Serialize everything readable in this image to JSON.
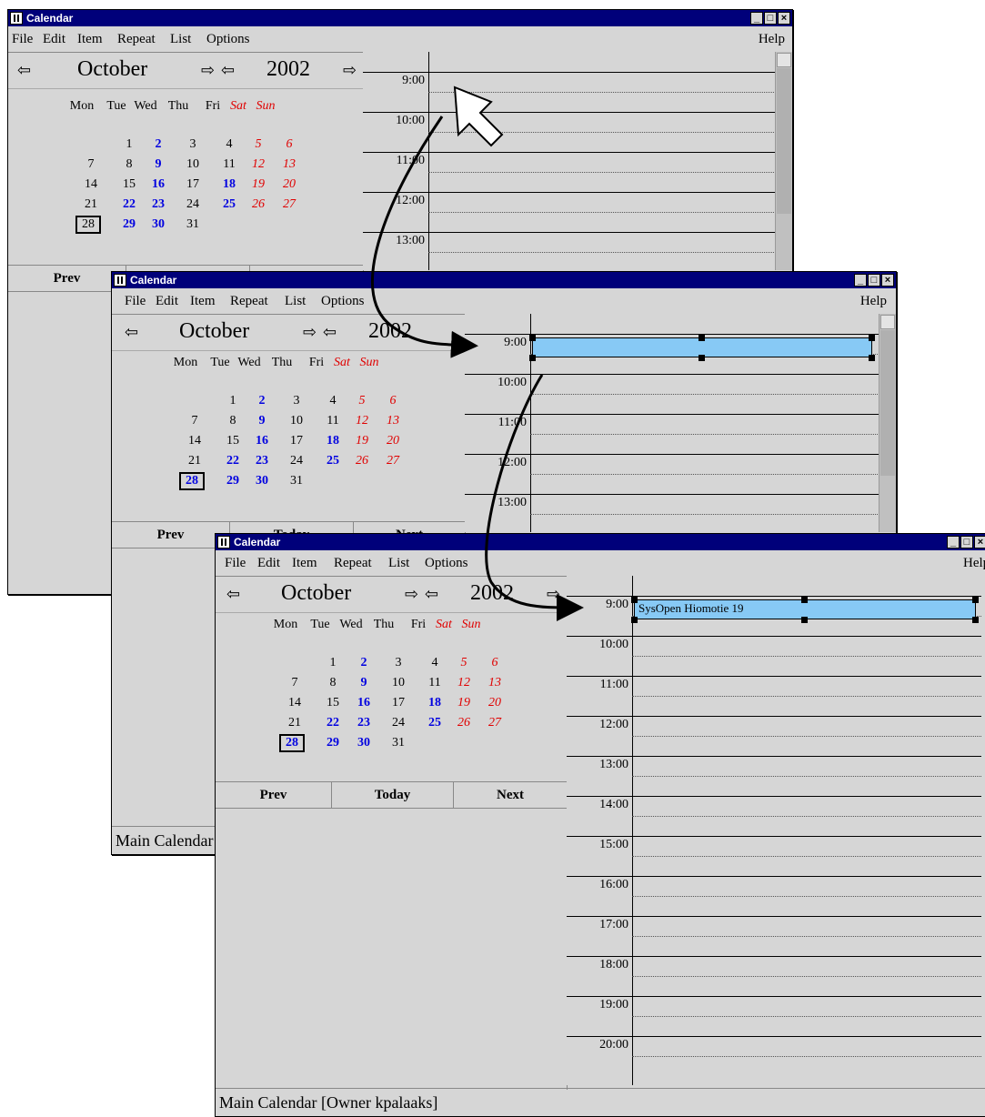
{
  "title": "Calendar",
  "menu": [
    "File",
    "Edit",
    "Item",
    "Repeat",
    "List",
    "Options"
  ],
  "help": "Help",
  "month": "October",
  "year": "2002",
  "weekdays": [
    "Mon",
    "Tue",
    "Wed",
    "Thu",
    "Fri",
    "Sat",
    "Sun"
  ],
  "buttons": {
    "prev": "Prev",
    "today": "Today",
    "next": "Next"
  },
  "times": [
    "9:00",
    "10:00",
    "11:00",
    "12:00",
    "13:00",
    "14:00",
    "15:00",
    "16:00",
    "17:00",
    "18:00",
    "19:00",
    "20:00"
  ],
  "event_text": "SysOpen Hiomotie 19",
  "status": "Main Calendar [Owner kpalaaks]",
  "selected_day": "28",
  "window_controls": [
    "minimize",
    "maximize",
    "close"
  ]
}
